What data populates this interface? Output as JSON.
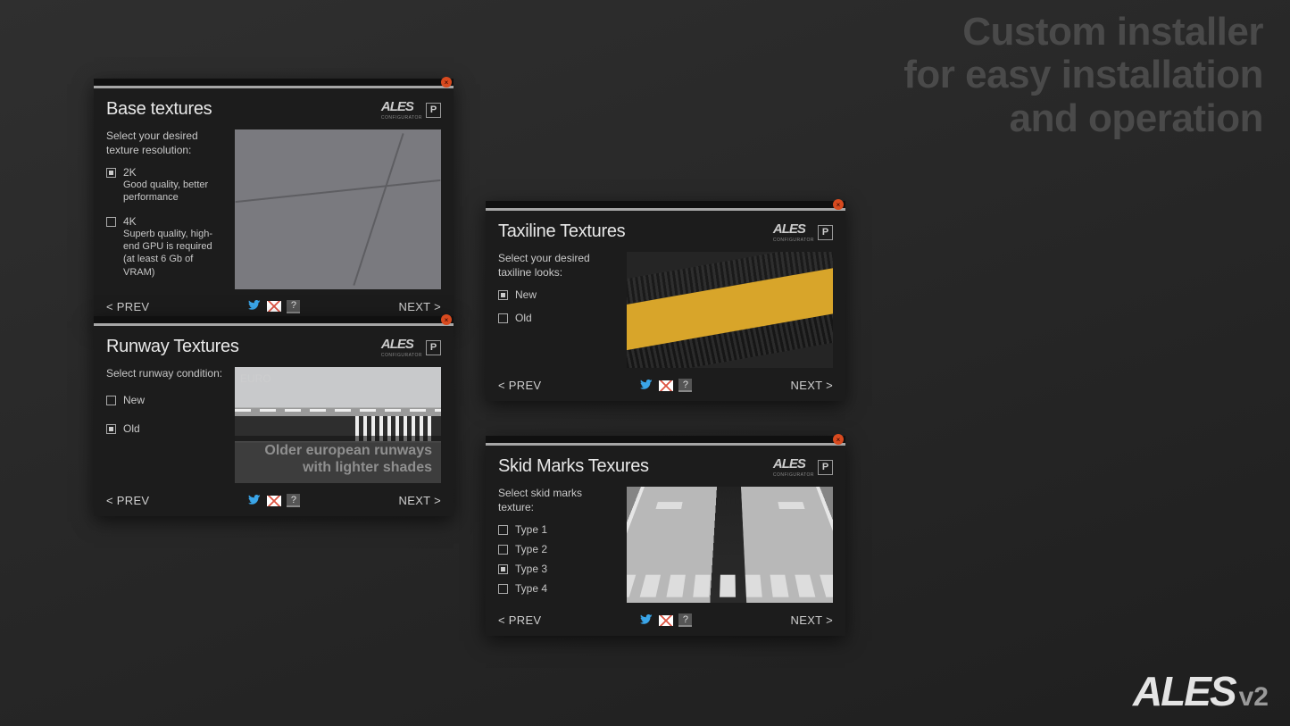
{
  "headline": [
    "Custom installer",
    "for easy installation",
    "and operation"
  ],
  "bottomlogo": {
    "main": "ALES",
    "suffix": "v2"
  },
  "nav": {
    "prev": "< PREV",
    "next": "NEXT >"
  },
  "brand": {
    "name": "ALES",
    "sub": "CONFIGURATOR",
    "psym": "P"
  },
  "windows": {
    "base": {
      "title": "Base textures",
      "instruction": "Select your desired texture resolution:",
      "options": [
        {
          "head": "2K",
          "desc": "Good quality, better performance",
          "checked": true
        },
        {
          "head": "4K",
          "desc": "Superb quality, high-end GPU is required (at least 6 Gb of VRAM)",
          "checked": false
        }
      ]
    },
    "runway": {
      "title": "Runway Textures",
      "instruction": "Select runway condition:",
      "options": [
        {
          "head": "New",
          "checked": false
        },
        {
          "head": "Old",
          "checked": true
        }
      ],
      "preview_label": "EURO",
      "preview_caption": [
        "Older european runways",
        "with lighter shades"
      ]
    },
    "taxi": {
      "title": "Taxiline Textures",
      "instruction": "Select your desired taxiline looks:",
      "options": [
        {
          "head": "New",
          "checked": true
        },
        {
          "head": "Old",
          "checked": false
        }
      ]
    },
    "skid": {
      "title": "Skid Marks Texures",
      "instruction": "Select skid marks texture:",
      "options": [
        {
          "head": "Type 1",
          "checked": false
        },
        {
          "head": "Type 2",
          "checked": false
        },
        {
          "head": "Type 3",
          "checked": true
        },
        {
          "head": "Type 4",
          "checked": false
        }
      ]
    }
  }
}
